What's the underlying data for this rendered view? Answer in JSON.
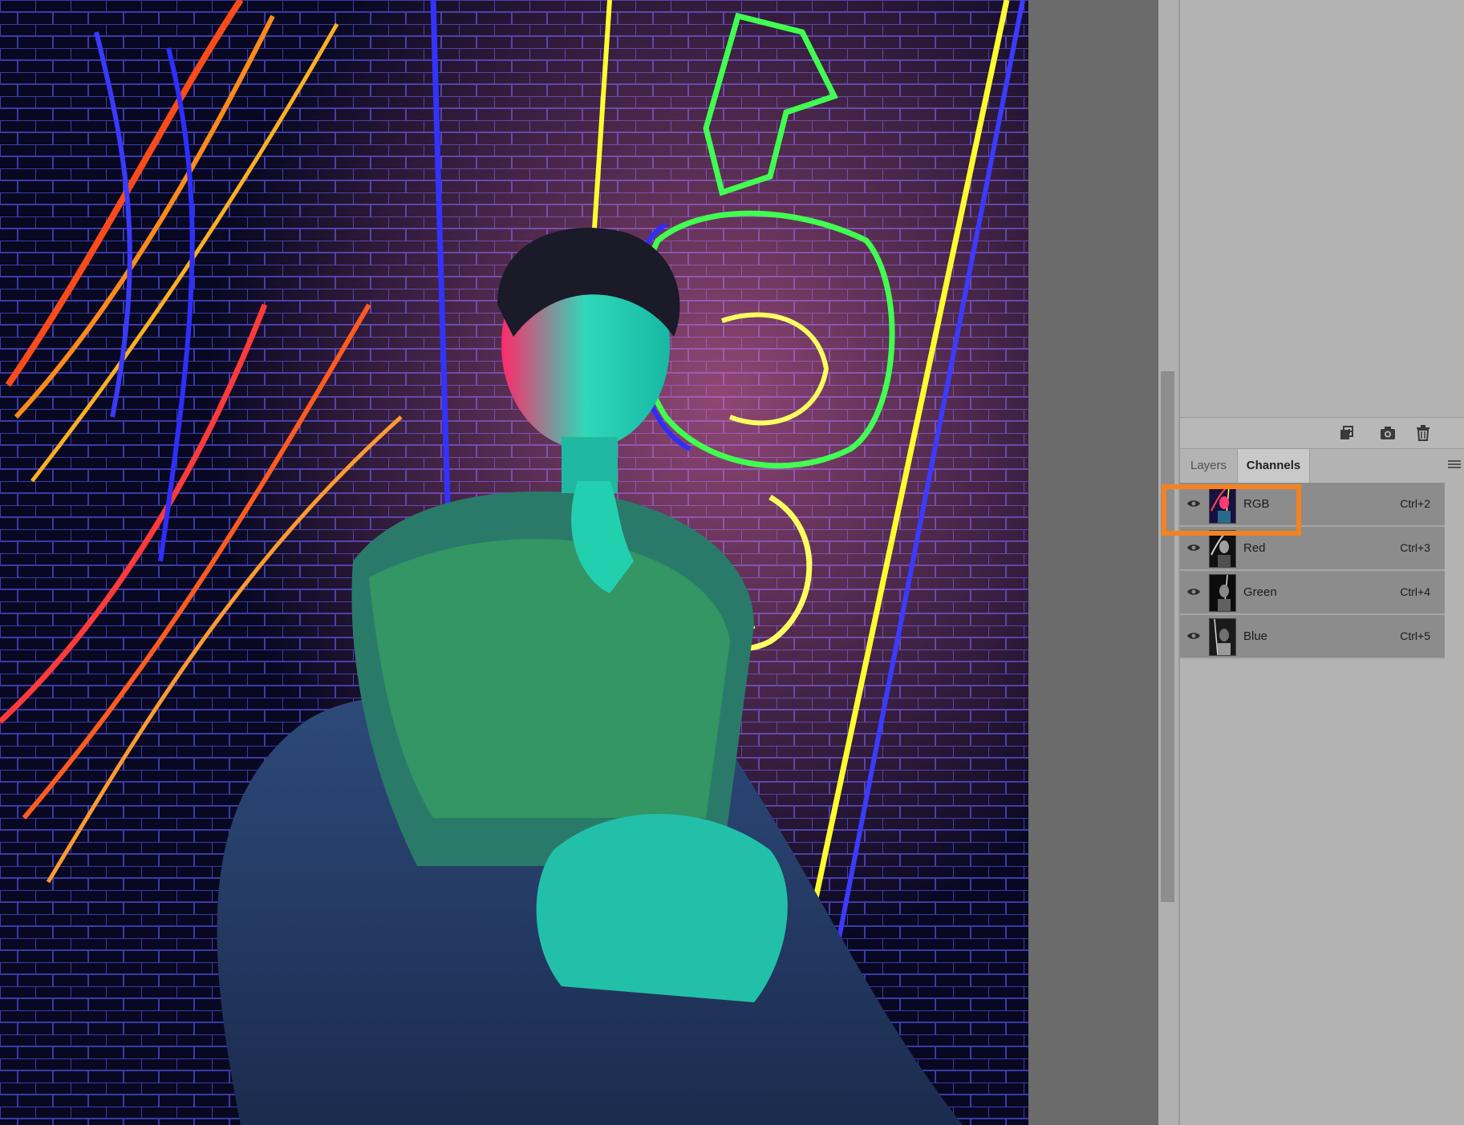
{
  "panel": {
    "tabs": [
      {
        "label": "Layers",
        "active": false
      },
      {
        "label": "Channels",
        "active": true
      }
    ],
    "toolbar_icons": [
      "save-selection-as-channel-icon",
      "camera-icon",
      "trash-icon"
    ],
    "menu_icon": "hamburger-menu-icon"
  },
  "channels": [
    {
      "name": "RGB",
      "shortcut": "Ctrl+2",
      "visible": true,
      "thumbnail": "color"
    },
    {
      "name": "Red",
      "shortcut": "Ctrl+3",
      "visible": true,
      "thumbnail": "grayscale"
    },
    {
      "name": "Green",
      "shortcut": "Ctrl+4",
      "visible": true,
      "thumbnail": "grayscale"
    },
    {
      "name": "Blue",
      "shortcut": "Ctrl+5",
      "visible": true,
      "thumbnail": "grayscale"
    }
  ],
  "colors": {
    "highlight": "#f58220",
    "panel_bg": "#b3b3b3",
    "row_bg": "#8c8c8c",
    "canvas_bg": "#6b6b6b"
  }
}
